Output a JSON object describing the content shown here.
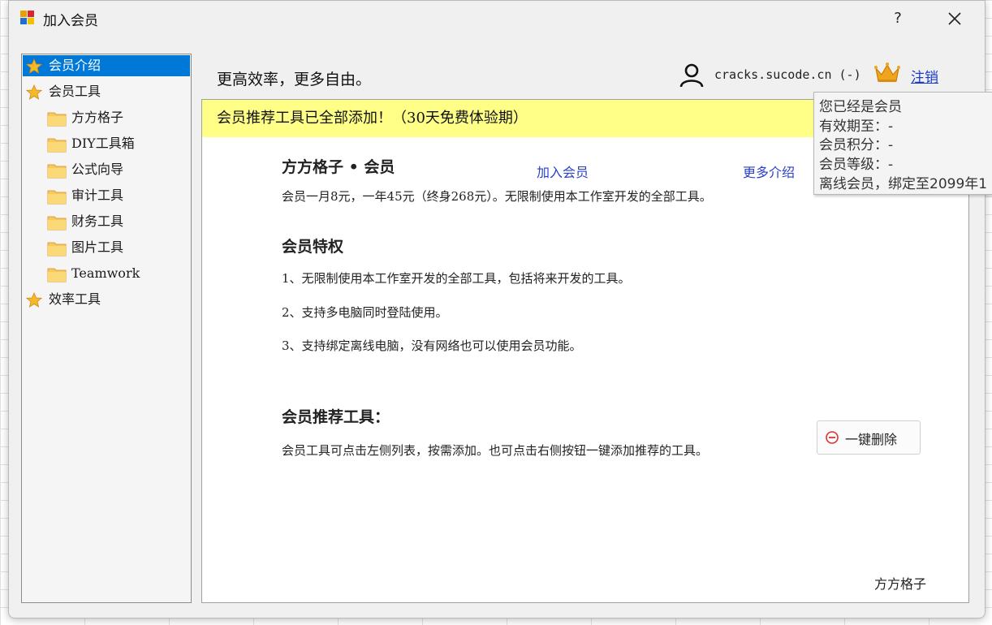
{
  "window": {
    "title": "加入会员",
    "help_glyph": "?",
    "close_icon": "close-icon"
  },
  "sidebar": {
    "items": [
      {
        "label": "会员介绍",
        "icon": "star-icon",
        "selected": true
      },
      {
        "label": "会员工具",
        "icon": "star-icon"
      },
      {
        "label": "方方格子",
        "icon": "folder-icon"
      },
      {
        "label": "DIY工具箱",
        "icon": "folder-icon"
      },
      {
        "label": "公式向导",
        "icon": "folder-icon"
      },
      {
        "label": "审计工具",
        "icon": "folder-icon"
      },
      {
        "label": "财务工具",
        "icon": "folder-icon"
      },
      {
        "label": "图片工具",
        "icon": "folder-icon"
      },
      {
        "label": "Teamwork",
        "icon": "folder-icon"
      },
      {
        "label": "效率工具",
        "icon": "star-icon"
      }
    ]
  },
  "header": {
    "slogan": "更高效率，更多自由。",
    "username": "cracks.sucode.cn (-)",
    "logout": "注销"
  },
  "tooltip": {
    "lines": [
      "您已经是会员",
      "有效期至：-",
      "会员积分：-",
      "会员等级：-",
      "离线会员，绑定至2099年1"
    ]
  },
  "main": {
    "banner": "会员推荐工具已全部添加！（30天免费体验期）",
    "product_title": "方方格子 • 会员",
    "join_link": "加入会员",
    "more_link": "更多介绍",
    "price_text": "会员一月8元，一年45元（终身268元）。无限制使用本工作室开发的全部工具。",
    "privilege_title": "会员特权",
    "privileges": [
      "1、无限制使用本工作室开发的全部工具，包括将来开发的工具。",
      "2、支持多电脑同时登陆使用。",
      "3、支持绑定离线电脑，没有网络也可以使用会员功能。"
    ],
    "recommend_title": "会员推荐工具：",
    "recommend_text": "会员工具可点击左侧列表，按需添加。也可点击右侧按钮一键添加推荐的工具。",
    "delete_button": "一键删除",
    "footer": "方方格子"
  },
  "colors": {
    "selection": "#0078d7",
    "banner": "#ffff88",
    "link": "#2a40c8"
  }
}
